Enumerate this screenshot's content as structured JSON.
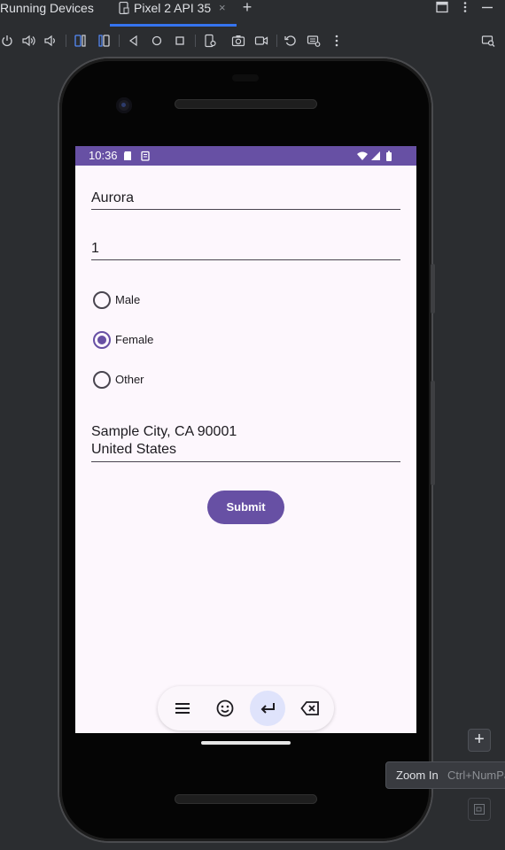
{
  "window": {
    "tool_title": "Running Devices",
    "device_tab": "Pixel 2 API 35",
    "tab_close": "×",
    "new_tab": "+"
  },
  "toolbar": {
    "icons": [
      "power-icon",
      "volume-up-icon",
      "volume-down-icon",
      "rotate-left-icon",
      "rotate-right-icon",
      "back-icon",
      "home-icon",
      "overview-icon",
      "device-settings-icon",
      "screenshot-icon",
      "screen-record-icon",
      "reset-icon",
      "keyboard-settings-icon",
      "more-icon",
      "device-mirror-icon"
    ]
  },
  "status_bar": {
    "time": "10:36",
    "color": "#6750a4"
  },
  "form": {
    "name_value": "Aurora",
    "number_value": "1",
    "gender_options": [
      {
        "label": "Male",
        "selected": false
      },
      {
        "label": "Female",
        "selected": true
      },
      {
        "label": "Other",
        "selected": false
      }
    ],
    "address_line1": "Sample City, CA 90001",
    "address_line2": "United States",
    "submit_label": "Submit",
    "accent": "#6750a4"
  },
  "keyboard_toolbar": {
    "buttons": [
      "menu-icon",
      "emoji-icon",
      "enter-icon",
      "backspace-icon"
    ],
    "active": "enter-icon"
  },
  "side_panel": {
    "zoom_in_symbol": "+",
    "tooltip_label": "Zoom In",
    "tooltip_shortcut": "Ctrl+NumPad +"
  }
}
